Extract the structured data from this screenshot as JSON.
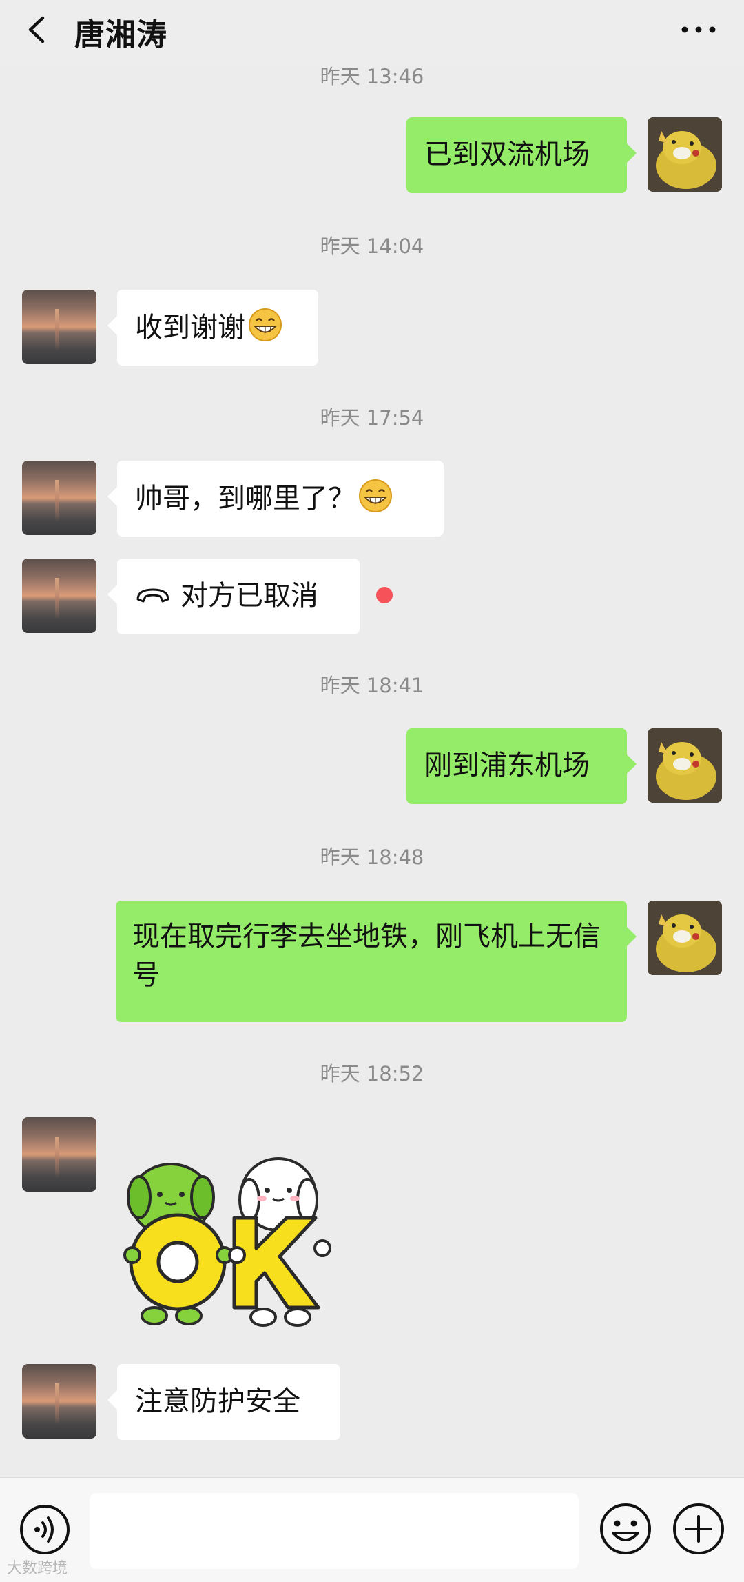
{
  "header": {
    "title": "唐湘涛"
  },
  "timestamps": {
    "t0": "昨天 13:46",
    "t1": "昨天 14:04",
    "t2": "昨天 17:54",
    "t3": "昨天 18:41",
    "t4": "昨天 18:48",
    "t5": "昨天 18:52"
  },
  "messages": {
    "m1": {
      "sender": "me",
      "text": "已到双流机场"
    },
    "m2": {
      "sender": "contact",
      "text": "收到谢谢",
      "emoji": "grin-emoji"
    },
    "m3": {
      "sender": "contact",
      "text": "帅哥，到哪里了？",
      "emoji": "grin-emoji"
    },
    "m4": {
      "sender": "contact",
      "text": "对方已取消",
      "icon": "call-cancelled-icon",
      "unread": true
    },
    "m5": {
      "sender": "me",
      "text": "刚到浦东机场"
    },
    "m6": {
      "sender": "me",
      "text": "现在取完行李去坐地铁，刚飞机上无信号"
    },
    "m7": {
      "sender": "contact",
      "sticker": "OK"
    },
    "m8": {
      "sender": "contact",
      "text": "注意防护安全"
    }
  },
  "sticker": {
    "text": "OK"
  },
  "input": {
    "value": "",
    "placeholder": ""
  },
  "watermark": "大数跨境",
  "colors": {
    "background": "#ececec",
    "outgoing_bubble": "#95ec69",
    "incoming_bubble": "#ffffff",
    "unread_dot": "#f5525a",
    "timestamp_text": "#8a8a8a"
  }
}
